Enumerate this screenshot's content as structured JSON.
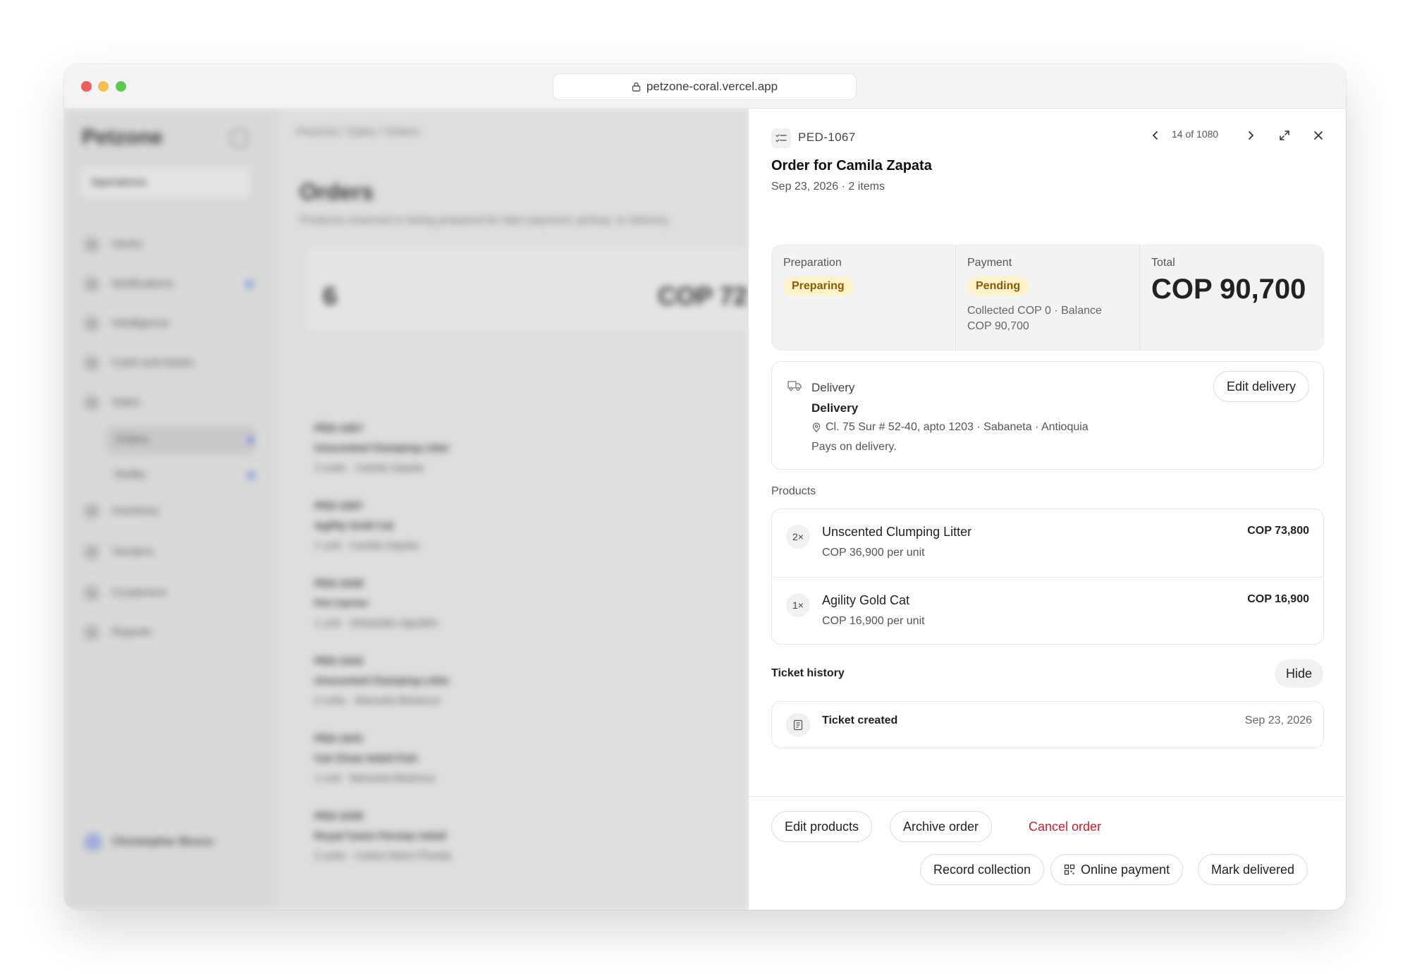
{
  "browser": {
    "url": "petzone-coral.vercel.app"
  },
  "background_app": {
    "logo": "Petzone",
    "workspace": "Operations",
    "nav": [
      "Home",
      "Notifications",
      "Intelligence",
      "Cash and banks",
      "Sales",
      "Orders",
      "Refills",
      "Inventory",
      "Vendors",
      "Customers",
      "Reports"
    ],
    "user": "Christopher Bosco",
    "breadcrumb": "Petzone / Sales / Orders",
    "page_title": "Orders",
    "page_subtitle": "Products reserved or being prepared for later payment, pickup, or delivery",
    "stat_open_value": "6",
    "stat_value": "COP 72",
    "rows": [
      {
        "id": "PED-1067",
        "name": "Unscented Clumping Litter",
        "meta": "2 units · Camila Zapata"
      },
      {
        "id": "PED-1067",
        "name": "Agility Gold Cat",
        "meta": "1 unit · Camila Zapata"
      },
      {
        "id": "PED-1049",
        "name": "Pet Carrier",
        "meta": "1 unit · Sebastián Agudelo"
      },
      {
        "id": "PED-1042",
        "name": "Unscented Clumping Litter",
        "meta": "2 units · Manuela Betancur"
      },
      {
        "id": "PED-1041",
        "name": "Cat Chow Adult Fish",
        "meta": "1 unit · Manuela Betancur"
      },
      {
        "id": "PED-1039",
        "name": "Royal Canin Persian Adult",
        "meta": "2 units · Carlos Mario Pineda"
      }
    ]
  },
  "drawer": {
    "order_id": "PED-1067",
    "counter": "14 of 1080",
    "title": "Order for Camila Zapata",
    "subtitle": "Sep 23, 2026 · 2 items",
    "preparation_label": "Preparation",
    "preparation_status": "Preparing",
    "payment_label": "Payment",
    "payment_status": "Pending",
    "collected_text": "Collected COP 0 · Balance COP 90,700",
    "total_label": "Total",
    "total_value": "COP 90,700",
    "status_color": "#fdf2c9",
    "delivery": {
      "section_label": "Delivery",
      "type": "Delivery",
      "address": "Cl. 75 Sur # 52-40, apto 1203 · Sabaneta · Antioquia",
      "payment_note": "Pays on delivery.",
      "edit_label": "Edit delivery"
    },
    "products_label": "Products",
    "products": [
      {
        "qty": "2×",
        "name": "Unscented Clumping Litter",
        "unit_price": "COP 36,900 per unit",
        "line_total": "COP 73,800"
      },
      {
        "qty": "1×",
        "name": "Agility Gold Cat",
        "unit_price": "COP 16,900 per unit",
        "line_total": "COP 16,900"
      }
    ],
    "history_label": "Ticket history",
    "history_toggle": "Hide",
    "history": [
      {
        "event": "Ticket created",
        "date": "Sep 23, 2026"
      }
    ],
    "actions": {
      "edit_products": "Edit products",
      "archive_order": "Archive order",
      "cancel_order": "Cancel order",
      "record_collection": "Record collection",
      "online_payment": "Online payment",
      "mark_delivered": "Mark delivered"
    },
    "cancel_color": "#c8202d"
  }
}
